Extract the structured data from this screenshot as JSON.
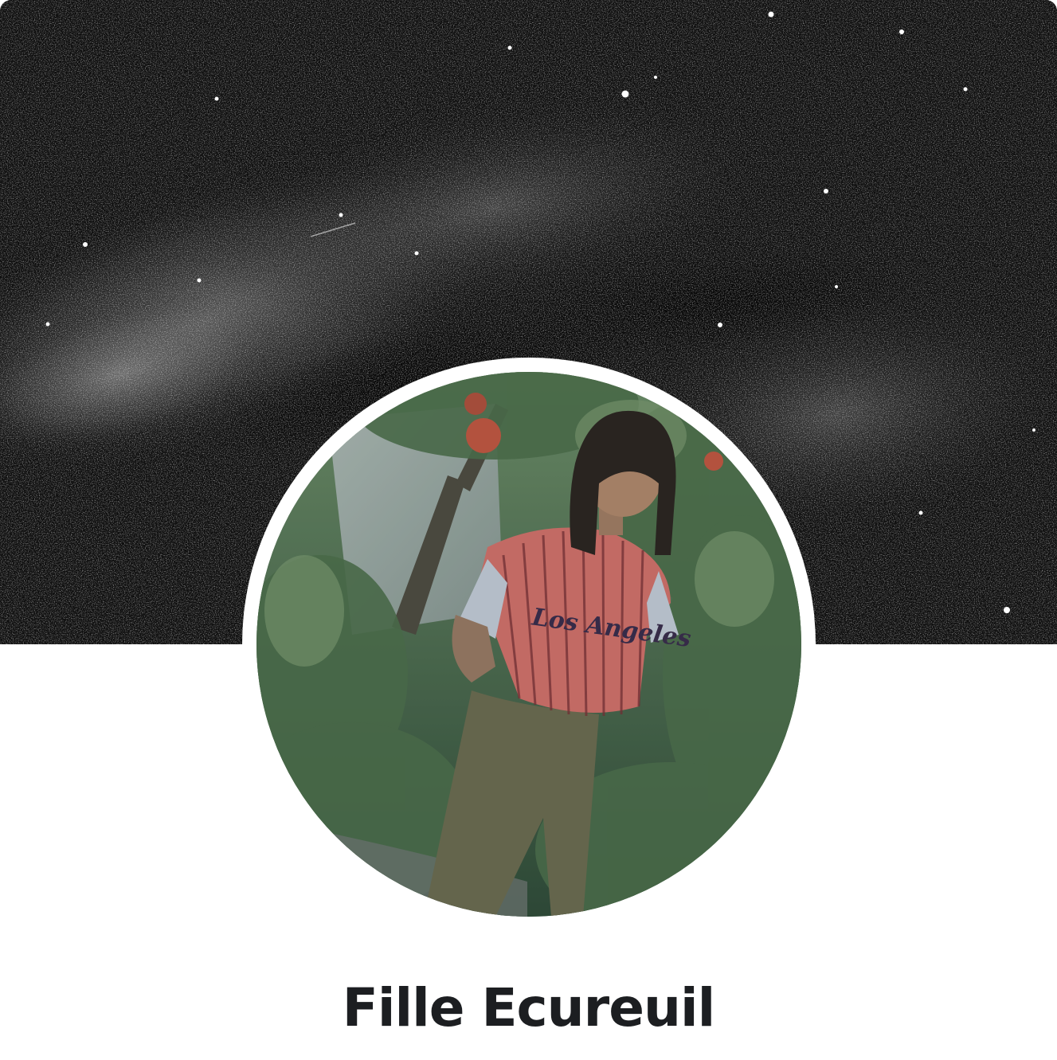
{
  "profile": {
    "name": "Fille Ecureuil",
    "cover_photo": "starry-night-sky-milky-way",
    "avatar_photo": "person-in-garden-wearing-striped-shirt",
    "shirt_text": "Los Angeles"
  },
  "colors": {
    "name_text": "#1c1e21",
    "background": "#ffffff",
    "ring": "#ffffff"
  }
}
